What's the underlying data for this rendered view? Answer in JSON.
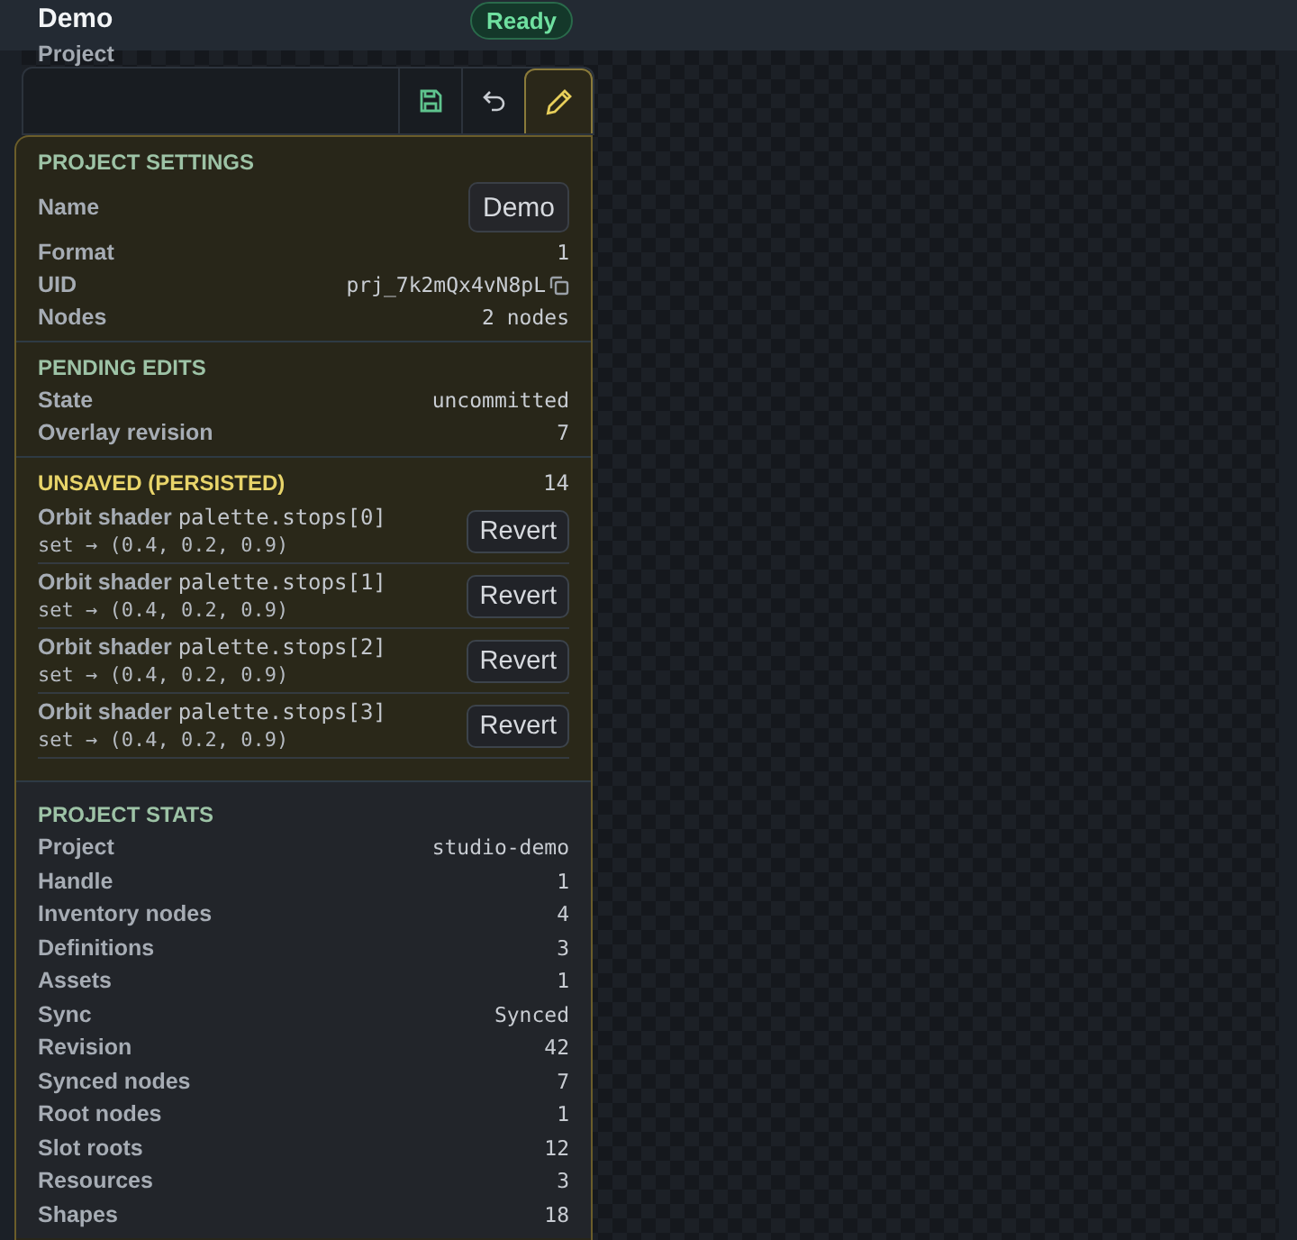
{
  "header": {
    "title": "Demo",
    "subtitle": "Project",
    "status": "Ready"
  },
  "toolbar": {
    "buttons": [
      {
        "kind": "save",
        "selected": false
      },
      {
        "kind": "undo",
        "selected": false
      },
      {
        "kind": "edit",
        "selected": true
      }
    ]
  },
  "sections": [
    {
      "kind": "settings",
      "title": "PROJECT SETTINGS",
      "rows": [
        {
          "kind": "input",
          "label": "Name",
          "value": "Demo"
        },
        {
          "kind": "text",
          "label": "Format",
          "value": "1"
        },
        {
          "kind": "copy",
          "label": "UID",
          "value": "prj_7k2mQx4vN8pL"
        },
        {
          "kind": "text",
          "label": "Nodes",
          "value": "2 nodes"
        }
      ]
    },
    {
      "kind": "pending",
      "title": "PENDING EDITS",
      "rows": [
        {
          "kind": "text",
          "label": "State",
          "value": "uncommitted"
        },
        {
          "kind": "text",
          "label": "Overlay revision",
          "value": "7"
        }
      ]
    },
    {
      "kind": "unsaved",
      "title": "UNSAVED (PERSISTED)",
      "count": "14",
      "changes": [
        {
          "target": "Orbit shader",
          "path": "palette.stops[0]",
          "detail": "set → (0.4, 0.2, 0.9)",
          "action": "Revert"
        },
        {
          "target": "Orbit shader",
          "path": "palette.stops[1]",
          "detail": "set → (0.4, 0.2, 0.9)",
          "action": "Revert"
        },
        {
          "target": "Orbit shader",
          "path": "palette.stops[2]",
          "detail": "set → (0.4, 0.2, 0.9)",
          "action": "Revert"
        },
        {
          "target": "Orbit shader",
          "path": "palette.stops[3]",
          "detail": "set → (0.4, 0.2, 0.9)",
          "action": "Revert"
        }
      ]
    },
    {
      "kind": "stats",
      "title": "PROJECT STATS",
      "rows": [
        {
          "kind": "text",
          "label": "Project",
          "value": "studio-demo"
        },
        {
          "kind": "text",
          "label": "Handle",
          "value": "1"
        },
        {
          "kind": "text",
          "label": "Inventory nodes",
          "value": "4"
        },
        {
          "kind": "text",
          "label": "Definitions",
          "value": "3"
        },
        {
          "kind": "text",
          "label": "Assets",
          "value": "1"
        },
        {
          "kind": "text",
          "label": "Sync",
          "value": "Synced"
        },
        {
          "kind": "text",
          "label": "Revision",
          "value": "42"
        },
        {
          "kind": "text",
          "label": "Synced nodes",
          "value": "7"
        },
        {
          "kind": "text",
          "label": "Root nodes",
          "value": "1"
        },
        {
          "kind": "text",
          "label": "Slot roots",
          "value": "12"
        },
        {
          "kind": "text",
          "label": "Resources",
          "value": "3"
        },
        {
          "kind": "text",
          "label": "Shapes",
          "value": "18"
        }
      ]
    }
  ]
}
